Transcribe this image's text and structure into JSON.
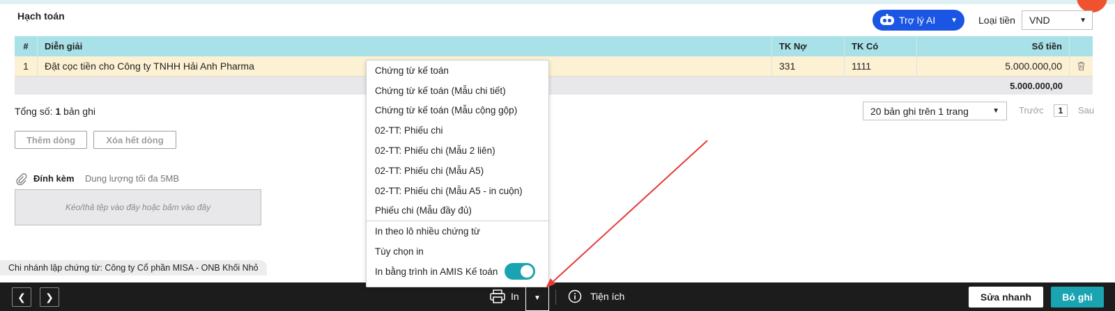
{
  "header": {
    "section_title": "Hạch toán",
    "ai_button": "Trợ lý AI",
    "currency_label": "Loại tiền",
    "currency_value": "VND"
  },
  "grid": {
    "columns": [
      "#",
      "Diễn giải",
      "TK Nợ",
      "TK Có",
      "Số tiền"
    ],
    "rows": [
      {
        "no": "1",
        "desc": "Đặt cọc tiền cho Công ty TNHH Hải Anh Pharma",
        "debit": "331",
        "credit": "1111",
        "amount": "5.000.000,00"
      }
    ],
    "total_amount": "5.000.000,00"
  },
  "summary": {
    "prefix": "Tổng số: ",
    "count": "1",
    "suffix": " bản ghi"
  },
  "pagination": {
    "page_size": "20 bản ghi trên 1 trang",
    "prev": "Trước",
    "current": "1",
    "next": "Sau"
  },
  "row_actions": {
    "add": "Thêm dòng",
    "clear": "Xóa hết dòng"
  },
  "attachments": {
    "label": "Đính kèm",
    "limit": "Dung lượng tối đa 5MB",
    "dropzone": "Kéo/thả tệp vào đây hoặc bấm vào đây"
  },
  "branch_note": "Chi nhánh lập chứng từ: Công ty Cổ phần MISA - ONB Khối Nhỏ",
  "footer": {
    "print": "In",
    "utilities": "Tiện ích",
    "quick_edit": "Sửa nhanh",
    "save": "Bỏ ghi"
  },
  "print_menu": {
    "items": [
      "Chứng từ kế toán",
      "Chứng từ kế toán (Mẫu chi tiết)",
      "Chứng từ kế toán (Mẫu cộng gộp)",
      "02-TT: Phiếu chi",
      "02-TT: Phiếu chi (Mẫu 2 liên)",
      "02-TT: Phiếu chi (Mẫu A5)",
      "02-TT: Phiếu chi (Mẫu A5 - in cuộn)",
      "Phiếu chi (Mẫu đầy đủ)"
    ],
    "extra_items": [
      "In theo lô nhiều chứng từ",
      "Tùy chọn in",
      "In bằng trình in AMIS Kế toán"
    ],
    "amis_printer_enabled": true
  },
  "colors": {
    "accent": "#1aa3b0",
    "ai_blue": "#1a55e4",
    "grid_header": "#a8e1e8",
    "row_highlight": "#fdf1d3",
    "annotation_arrow": "#e53935"
  }
}
